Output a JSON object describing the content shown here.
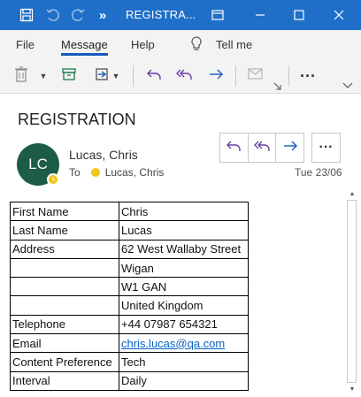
{
  "window": {
    "title": "REGISTRA...",
    "overflow_label": "»"
  },
  "menu": {
    "items": [
      "File",
      "Message",
      "Help"
    ],
    "active": "Message",
    "tell_me": "Tell me"
  },
  "message": {
    "subject": "REGISTRATION",
    "sender_initials": "LC",
    "sender_name": "Lucas, Chris",
    "to_label": "To",
    "to_name": "Lucas, Chris",
    "date": "Tue 23/06",
    "more_label": "···"
  },
  "table": {
    "rows": [
      [
        "First Name",
        "Chris"
      ],
      [
        "Last Name",
        "Lucas"
      ],
      [
        "Address",
        "62 West Wallaby Street"
      ],
      [
        "",
        "Wigan"
      ],
      [
        "",
        "W1 GAN"
      ],
      [
        "",
        "United Kingdom"
      ],
      [
        "Telephone",
        "+44 07987 654321"
      ],
      [
        "Email",
        "chris.lucas@qa.com"
      ],
      [
        "Content Preference",
        "Tech"
      ],
      [
        "Interval",
        "Daily"
      ]
    ]
  },
  "colors": {
    "titlebar": "#1f6fc8",
    "avatar": "#1e5c4a",
    "accent": "#6b3fa0",
    "link": "#0563c1",
    "presence": "#f5c518"
  },
  "icons": [
    "save-icon",
    "undo-icon",
    "redo-icon",
    "popout-icon",
    "minimize-icon",
    "maximize-icon",
    "close-icon",
    "delete-icon",
    "archive-icon",
    "move-icon",
    "reply-icon",
    "reply-all-icon",
    "forward-icon",
    "meeting-icon",
    "more-icon",
    "lightbulb-icon"
  ]
}
